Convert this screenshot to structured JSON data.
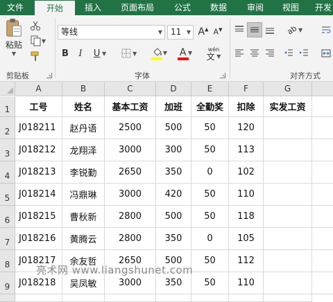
{
  "ribbon": {
    "tabs": [
      {
        "label": "文件",
        "active": false
      },
      {
        "label": "开始",
        "active": true
      },
      {
        "label": "插入",
        "active": false
      },
      {
        "label": "页面布局",
        "active": false
      },
      {
        "label": "公式",
        "active": false
      },
      {
        "label": "数据",
        "active": false
      },
      {
        "label": "审阅",
        "active": false
      },
      {
        "label": "视图",
        "active": false
      },
      {
        "label": "开发",
        "active": false
      }
    ],
    "clipboard": {
      "paste_label": "粘贴",
      "group_label": "剪贴板"
    },
    "font": {
      "font_name": "等线",
      "font_size": "11",
      "group_label": "字体",
      "fill_color": "#ffff00",
      "font_color": "#ff0000",
      "wen_label": "wén",
      "wen_glyph": "文"
    },
    "alignment": {
      "group_label": "对齐方式"
    }
  },
  "sheet": {
    "columns": [
      "A",
      "B",
      "C",
      "D",
      "E",
      "F",
      "G"
    ],
    "row_numbers": [
      "1",
      "2",
      "3",
      "4",
      "5",
      "6",
      "7",
      "8",
      "9"
    ],
    "headers": [
      "工号",
      "姓名",
      "基本工资",
      "加班",
      "全勤奖",
      "扣除",
      "实发工资"
    ],
    "rows": [
      [
        "J018211",
        "赵丹语",
        "2500",
        "500",
        "50",
        "120",
        ""
      ],
      [
        "J018212",
        "龙翔泽",
        "3000",
        "300",
        "50",
        "113",
        ""
      ],
      [
        "J018213",
        "李锐勤",
        "2650",
        "350",
        "0",
        "102",
        ""
      ],
      [
        "J018214",
        "冯鼎琳",
        "3000",
        "420",
        "50",
        "110",
        ""
      ],
      [
        "J018215",
        "曹秋新",
        "2800",
        "500",
        "50",
        "118",
        ""
      ],
      [
        "J018216",
        "黄腾云",
        "2800",
        "350",
        "0",
        "105",
        ""
      ],
      [
        "J018217",
        "余友哲",
        "2650",
        "500",
        "50",
        "112",
        ""
      ],
      [
        "J018218",
        "吴凤敏",
        "3000",
        "350",
        "50",
        "110",
        ""
      ]
    ]
  },
  "watermark": "亮术网 www.liangshunet.com"
}
